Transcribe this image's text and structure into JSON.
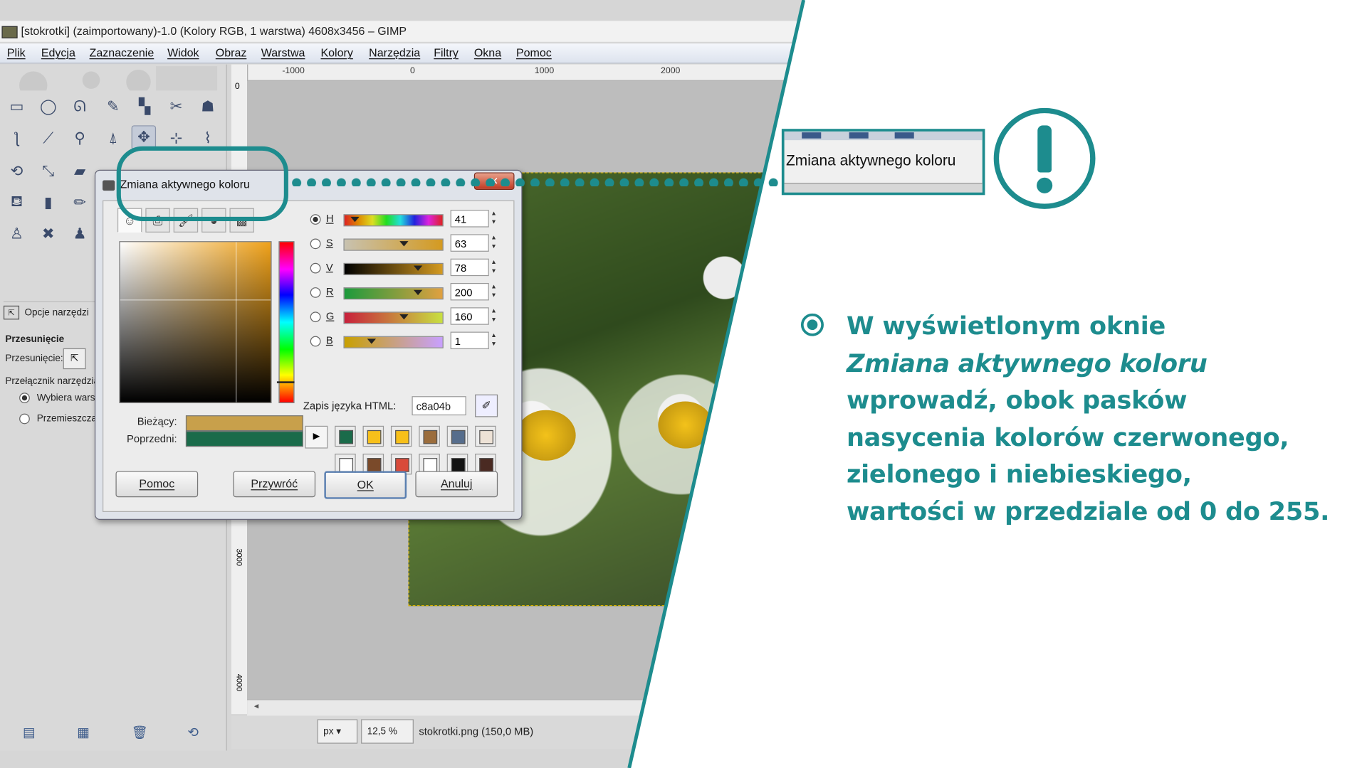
{
  "window": {
    "title": "[stokrotki] (zaimportowany)-1.0 (Kolory RGB, 1 warstwa) 4608x3456 – GIMP"
  },
  "menu": [
    "Plik",
    "Edycja",
    "Zaznaczenie",
    "Widok",
    "Obraz",
    "Warstwa",
    "Kolory",
    "Narzędzia",
    "Filtry",
    "Okna",
    "Pomoc"
  ],
  "ruler": {
    "ticks": [
      "-1000",
      "0",
      "1000",
      "2000"
    ],
    "left_marks": [
      "0",
      "3000",
      "4000"
    ]
  },
  "toolbox": {
    "tool_options_title": "Opcje narzędzi",
    "section": "Przesunięcie",
    "move_label": "Przesunięcie:",
    "switch_label": "Przełącznik narzędzia",
    "option_pick": "Wybiera warstwę",
    "option_move": "Przemieszcza"
  },
  "statusbar": {
    "unit": "px",
    "zoom": "12,5 %",
    "file": "stokrotki.png (150,0 MB)"
  },
  "dialog": {
    "title": "Zmiana aktywnego koloru",
    "current_label": "Bieżący:",
    "previous_label": "Poprzedni:",
    "current_color": "#c8a04b",
    "previous_color": "#1a6b4a",
    "sliders": [
      {
        "name": "H",
        "value": "41",
        "selected": true,
        "level": 0.11
      },
      {
        "name": "S",
        "value": "63",
        "selected": false,
        "level": 0.63
      },
      {
        "name": "V",
        "value": "78",
        "selected": false,
        "level": 0.78
      },
      {
        "name": "R",
        "value": "200",
        "selected": false,
        "level": 0.78
      },
      {
        "name": "G",
        "value": "160",
        "selected": false,
        "level": 0.63
      },
      {
        "name": "B",
        "value": "1",
        "selected": false,
        "level": 0.29
      }
    ],
    "html_label": "Zapis języka HTML:",
    "html_value": "c8a04b",
    "history": [
      "#1a6b4a",
      "#f7c01a",
      "#f7c01a",
      "#9b6d3c",
      "#566d8c",
      "#ede2d6",
      "#ffffff",
      "#7a4a2a",
      "#d94a3a",
      "#ffffff",
      "#111111",
      "#4a2a22"
    ],
    "buttons": {
      "help": "Pomoc",
      "reset": "Przywróć",
      "ok": "OK",
      "cancel": "Anuluj"
    }
  },
  "callout": {
    "zoom_text": "Zmiana aktywnego koloru"
  },
  "instruction": {
    "line1": "W wyświetlonym oknie",
    "line2": "Zmiana aktywnego koloru",
    "line3": "wprowadź, obok pasków",
    "line4": "nasycenia kolorów czerwonego,",
    "line5": "zielonego i niebieskiego,",
    "line6": "wartości w przedziale od 0 do 255."
  },
  "colors": {
    "accent": "#1d8c8e"
  }
}
